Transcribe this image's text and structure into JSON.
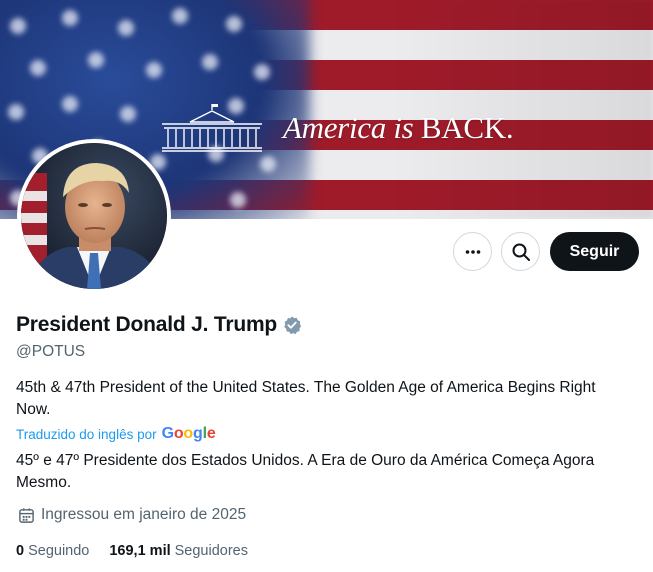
{
  "banner": {
    "tagline_italic": "America is",
    "tagline_upright": "BACK."
  },
  "actions": {
    "more_icon": "more-horizontal-icon",
    "search_icon": "search-icon",
    "follow_label": "Seguir"
  },
  "profile": {
    "display_name": "President Donald J. Trump",
    "verified_icon": "verified-badge-icon",
    "verified_color": "#829aab",
    "handle": "@POTUS",
    "bio": "45th & 47th President of the United States. The Golden Age of America Begins Right Now.",
    "translated_label": "Traduzido do inglês por",
    "translated_provider": "Google",
    "bio_translated": "45º e 47º Presidente dos Estados Unidos. A Era de Ouro da América Começa Agora Mesmo.",
    "joined_icon": "calendar-icon",
    "joined": "Ingressou em janeiro de 2025"
  },
  "stats": {
    "following_count": "0",
    "following_label": "Seguindo",
    "followers_count": "169,1 mil",
    "followers_label": "Seguidores"
  },
  "colors": {
    "link": "#1d9bf0",
    "secondary_text": "#536471",
    "primary_text": "#0f1419",
    "follow_button": "#0f1419"
  }
}
